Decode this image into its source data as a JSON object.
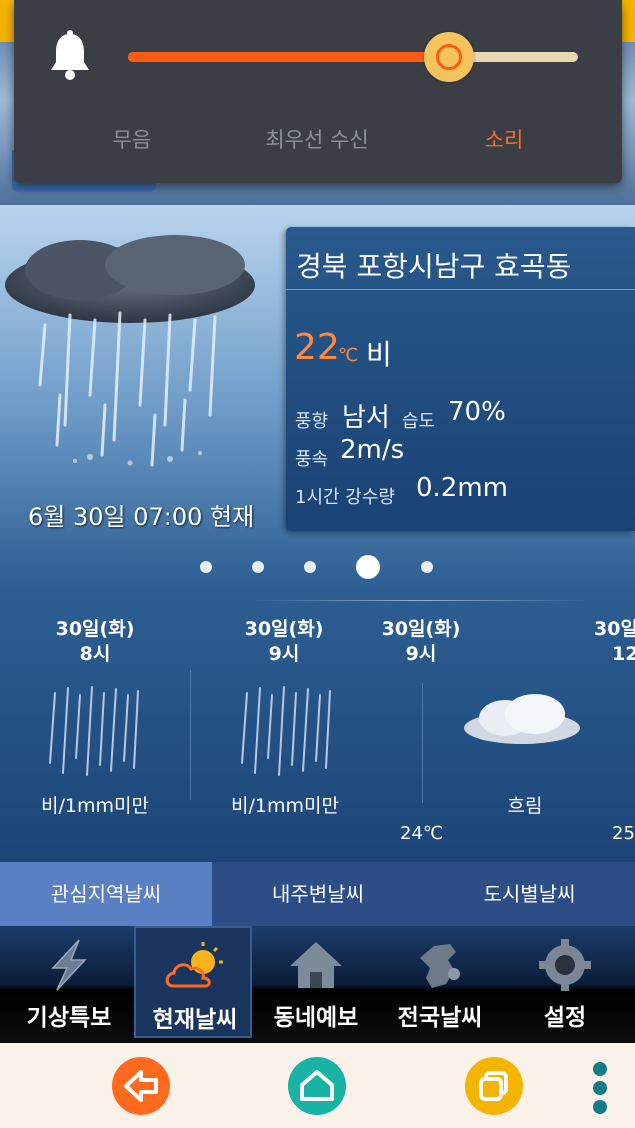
{
  "volume": {
    "level_percent": 70,
    "options": [
      "무음",
      "최우선 수신",
      "소리"
    ],
    "active_option": "소리"
  },
  "current": {
    "location": "경북 포항시남구 효곡동",
    "temp": "22",
    "temp_unit": "℃",
    "condition": "비",
    "wind_dir_label": "풍향",
    "wind_dir": "남서",
    "humidity_label": "습도",
    "humidity": "70%",
    "wind_speed_label": "풍속",
    "wind_speed": "2m/s",
    "precip_label": "1시간 강수량",
    "precip": "0.2mm",
    "observed": "6월 30일 07:00 현재"
  },
  "pager": {
    "count": 5,
    "active_index": 3
  },
  "hourly": [
    {
      "day": "30일(화)",
      "hour": "8시",
      "cond": "비/1mm미만",
      "temp": "",
      "icon": "rain-icon"
    },
    {
      "day": "30일(화)",
      "hour": "9시",
      "cond": "비/1mm미만",
      "temp": "",
      "icon": "rain-icon"
    },
    {
      "day": "30일(화)",
      "hour": "9시",
      "cond": "흐림",
      "temp": "24℃",
      "icon": "cloud-icon"
    },
    {
      "day": "30일",
      "hour": "12",
      "cond": "",
      "temp": "25",
      "icon": "none"
    }
  ],
  "region_tabs": [
    "관심지역날씨",
    "내주변날씨",
    "도시별날씨"
  ],
  "nav": [
    {
      "label": "기상특보",
      "icon": "lightning-icon"
    },
    {
      "label": "현재날씨",
      "icon": "sun-cloud-icon"
    },
    {
      "label": "동네예보",
      "icon": "house-icon"
    },
    {
      "label": "전국날씨",
      "icon": "korea-map-icon"
    },
    {
      "label": "설정",
      "icon": "gear-icon"
    }
  ],
  "system_nav": [
    "back-icon",
    "home-icon",
    "recents-icon",
    "more-icon"
  ],
  "colors": {
    "accent": "#ff6a1f",
    "panel": "#3b3f45",
    "nav_active": "#19355e"
  }
}
